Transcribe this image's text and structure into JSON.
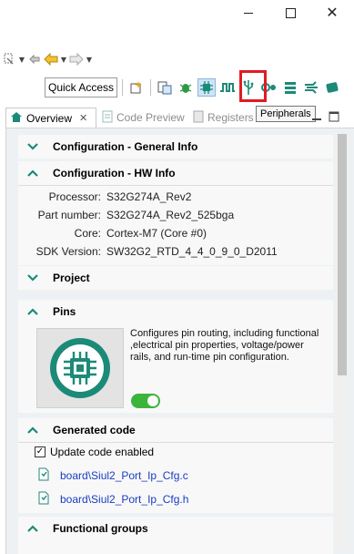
{
  "tooltip": {
    "text": "Peripherals"
  },
  "quick_access": {
    "label": "Quick Access"
  },
  "tabs": [
    {
      "label": "Overview",
      "active": true
    },
    {
      "label": "Code Preview",
      "active": false
    },
    {
      "label": "Registers",
      "active": false
    }
  ],
  "sections": {
    "general_info": {
      "title": "Configuration - General Info",
      "expanded": false
    },
    "hw_info": {
      "title": "Configuration - HW Info",
      "expanded": true,
      "rows": [
        {
          "label": "Processor:",
          "value": "S32G274A_Rev2"
        },
        {
          "label": "Part number:",
          "value": "S32G274A_Rev2_525bga"
        },
        {
          "label": "Core:",
          "value": "Cortex-M7 (Core #0)"
        },
        {
          "label": "SDK Version:",
          "value": "SW32G2_RTD_4_4_0_9_0_D2011"
        }
      ]
    },
    "project": {
      "title": "Project",
      "expanded": false
    },
    "pins": {
      "title": "Pins",
      "expanded": true,
      "description": "Configures pin routing, including functional ,electrical pin properties, voltage/power rails, and run-time pin configuration.",
      "enabled": true
    },
    "generated_code": {
      "title": "Generated code",
      "expanded": true,
      "update_label": "Update code enabled",
      "update_checked": true,
      "files": [
        "board\\Siul2_Port_Ip_Cfg.c",
        "board\\Siul2_Port_Ip_Cfg.h"
      ]
    },
    "functional_groups": {
      "title": "Functional groups",
      "expanded": true
    }
  },
  "colors": {
    "accent_teal": "#1c8a78",
    "highlight_red": "#e01b24",
    "toggle_green": "#3bb43c",
    "link_blue": "#1a3dc1"
  }
}
